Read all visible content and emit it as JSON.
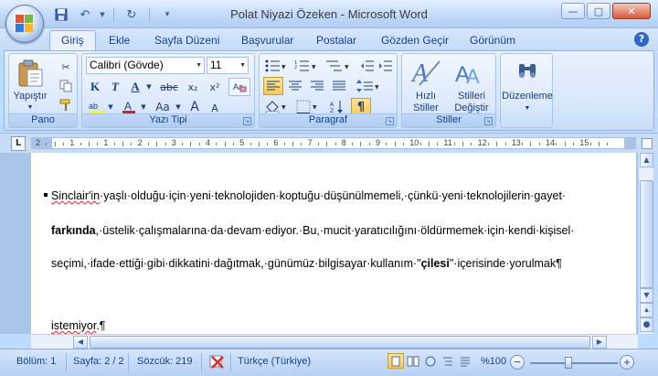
{
  "window": {
    "title": "Polat Niyazi Özeken - Microsoft Word",
    "buttons": {
      "minimize": "—",
      "maximize": "▢",
      "close": "✕"
    }
  },
  "quick_access": [
    "save-icon",
    "undo-icon",
    "redo-icon",
    "customize-icon"
  ],
  "tabs": [
    "Giriş",
    "Ekle",
    "Sayfa Düzeni",
    "Başvurular",
    "Postalar",
    "Gözden Geçir",
    "Görünüm"
  ],
  "active_tab": "Giriş",
  "ribbon": {
    "pano": {
      "label": "Pano",
      "paste_label": "Yapıştır"
    },
    "font": {
      "label": "Yazı Tipi",
      "font_name": "Calibri (Gövde)",
      "font_size": "11",
      "bold": "K",
      "italic": "T",
      "underline": "A",
      "strike": "abc",
      "sub": "x₂",
      "sup": "x²",
      "case": "Aa",
      "grow": "A",
      "shrink": "A"
    },
    "paragraph": {
      "label": "Paragraf",
      "pilcrow": "¶"
    },
    "styles": {
      "label": "Stiller",
      "quick_styles": "Hızlı\nStiller",
      "quick_styles_1": "Hızlı",
      "quick_styles_2": "Stiller",
      "change_1": "Stilleri",
      "change_2": "Değiştir"
    },
    "editing": {
      "label": "Düzenleme"
    }
  },
  "ruler": {
    "numbers": [
      "2",
      "1",
      "1",
      "2",
      "3",
      "4",
      "5",
      "6",
      "7",
      "8",
      "9",
      "10",
      "11",
      "12",
      "13",
      "14",
      "15"
    ]
  },
  "document": {
    "lines": [
      "Sinclair'in·yaşlı·olduğu·için·yeni·teknolojiden·koptuğu·düşünülmemeli,·çünkü·yeni·teknolojilerin·gayet·",
      "farkında,·üstelik·çalışmalarına·da·devam·ediyor.·Bu,·mucit·yaratıcılığını·öldürmemek·için·kendi·kişisel·",
      "seçimi,·ifade·ettiği·gibi·dikkatini·dağıtmak,·günümüz·bilgisayar·kullanım·\"çilesi\"·içerisinde·yorulmak¶",
      "istemiyor.¶"
    ],
    "line1_parts": {
      "a": "Sinclair'in",
      "b": "·yaşlı·olduğu·için·yeni·teknolojiden·koptuğu·düşünülmemeli,·çünkü·yeni·teknolojilerin·gayet·"
    },
    "line2_parts": {
      "bold": "farkında",
      "rest": ",·üstelik·çalışmalarına·da·devam·ediyor.·Bu,·mucit·yaratıcılığını·öldürmemek·için·kendi·kişisel·"
    },
    "line3_parts": {
      "a": "seçimi,·ifade·ettiği·gibi·dikkatini·dağıtmak,·günümüz·bilgisayar·kullanım·\"",
      "bold": "çilesi",
      "b": "\"·içerisinde·yorulmak¶"
    },
    "line4_parts": {
      "a": "istemiyor",
      "b": ".¶"
    }
  },
  "status": {
    "section": "Bölüm: 1",
    "page": "Sayfa: 2 / 2",
    "words": "Sözcük: 219",
    "language": "Türkçe (Türkiye)",
    "zoom": "%100",
    "zoom_minus": "−",
    "zoom_plus": "+"
  },
  "colors": {
    "ribbon": "#d7e6fb",
    "accent": "#15428b",
    "squiggle": "#ee2233"
  }
}
